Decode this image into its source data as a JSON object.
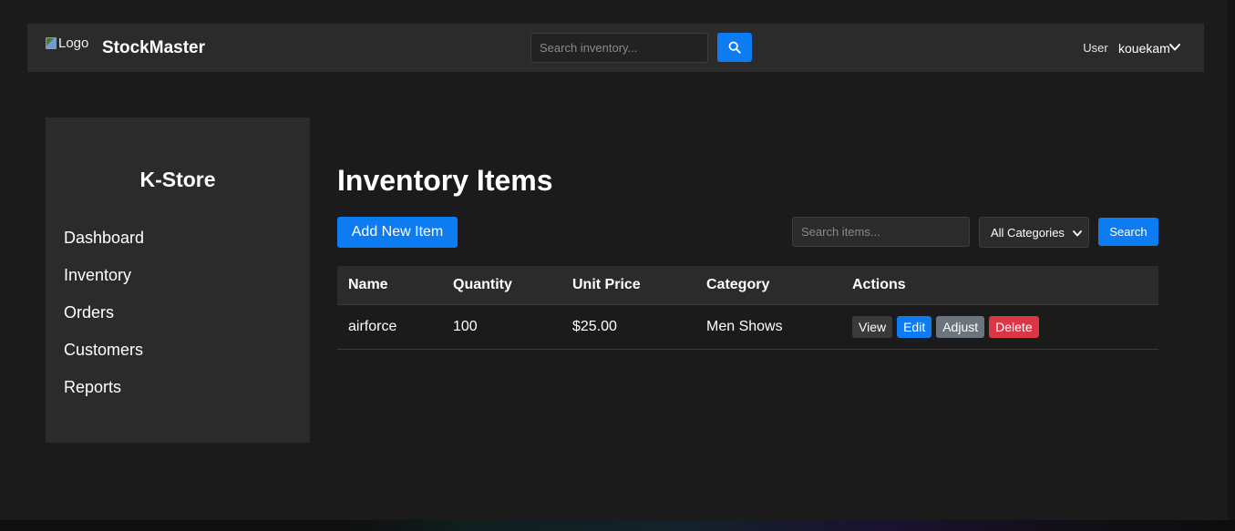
{
  "header": {
    "logo_alt": "Logo",
    "brand": "StockMaster",
    "search_placeholder": "Search inventory...",
    "avatar_alt": "User",
    "username": "kouekam"
  },
  "sidebar": {
    "store_name": "K-Store",
    "items": [
      {
        "label": "Dashboard"
      },
      {
        "label": "Inventory"
      },
      {
        "label": "Orders"
      },
      {
        "label": "Customers"
      },
      {
        "label": "Reports"
      }
    ]
  },
  "main": {
    "title": "Inventory Items",
    "add_button": "Add New Item",
    "search_placeholder": "Search items...",
    "category_selected": "All Categories",
    "search_button": "Search",
    "table": {
      "columns": [
        "Name",
        "Quantity",
        "Unit Price",
        "Category",
        "Actions"
      ],
      "rows": [
        {
          "name": "airforce",
          "quantity": "100",
          "unit_price": "$25.00",
          "category": "Men Shows",
          "actions": [
            "View",
            "Edit",
            "Adjust",
            "Delete"
          ]
        }
      ]
    }
  },
  "colors": {
    "background": "#1b1b1b",
    "panel": "#2b2b2b",
    "primary": "#0d7cf2",
    "danger": "#dc3545",
    "secondary": "#6c757d"
  },
  "icons": {
    "header_search": "search-icon",
    "user_menu": "chevron-down-icon",
    "category_select": "chevron-down-icon"
  }
}
